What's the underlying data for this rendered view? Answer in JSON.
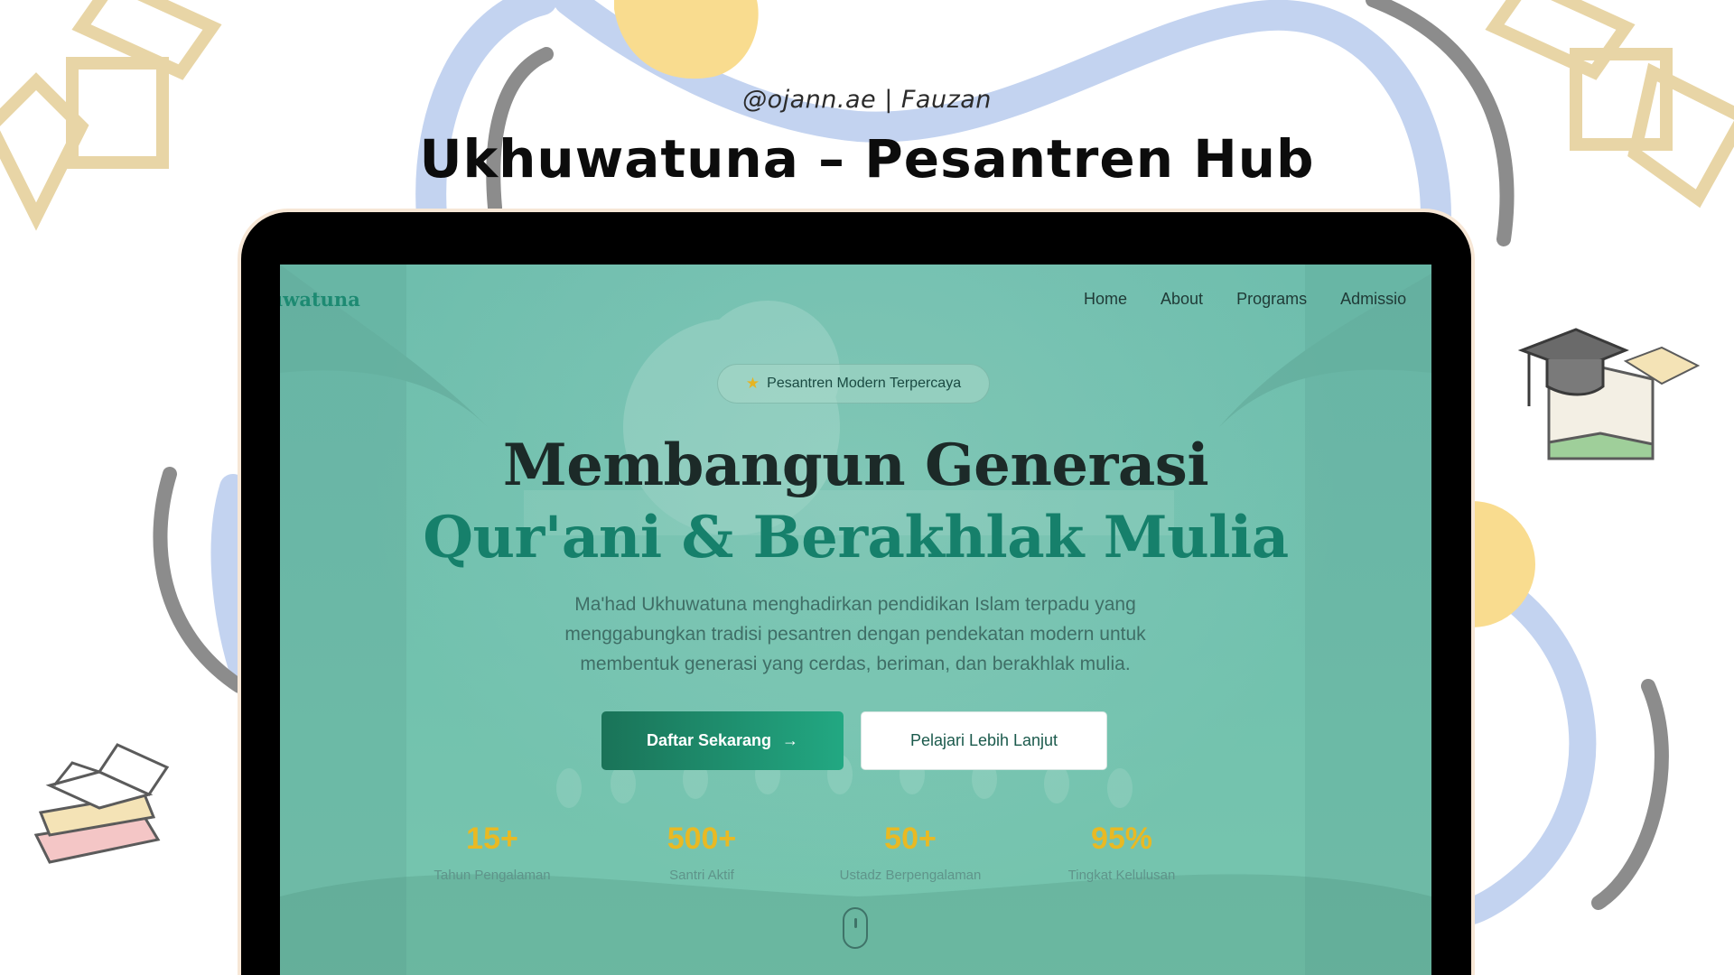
{
  "header": {
    "author": "@ojann.ae | Fauzan",
    "title": "Ukhuwatuna – Pesantren Hub"
  },
  "site": {
    "brand": "uwatuna",
    "nav": [
      "Home",
      "About",
      "Programs",
      "Admissio"
    ]
  },
  "hero": {
    "badge": "Pesantren Modern Terpercaya",
    "badge_icon": "star-icon",
    "headline_line1": "Membangun Generasi",
    "headline_line2": "Qur'ani & Berakhlak Mulia",
    "description_lines": [
      "Ma'had Ukhuwatuna menghadirkan pendidikan Islam terpadu yang",
      "menggabungkan tradisi pesantren dengan pendekatan modern untuk",
      "membentuk generasi yang cerdas, beriman, dan berakhlak mulia."
    ],
    "primary_button": "Daftar Sekarang",
    "primary_button_icon": "arrow-right-icon",
    "secondary_button": "Pelajari Lebih Lanjut"
  },
  "stats": [
    {
      "value": "15+",
      "label": "Tahun Pengalaman"
    },
    {
      "value": "500+",
      "label": "Santri Aktif"
    },
    {
      "value": "50+",
      "label": "Ustadz Berpengalaman"
    },
    {
      "value": "95%",
      "label": "Tingkat Kelulusan"
    }
  ],
  "colors": {
    "accent_green": "#16806b",
    "stat_gold": "#e9b923",
    "deco_blue": "#c3d3f0",
    "deco_gold": "#f9dc8f",
    "deco_pattern": "#e8d5a6",
    "screen_bg": "#70c0ae"
  }
}
